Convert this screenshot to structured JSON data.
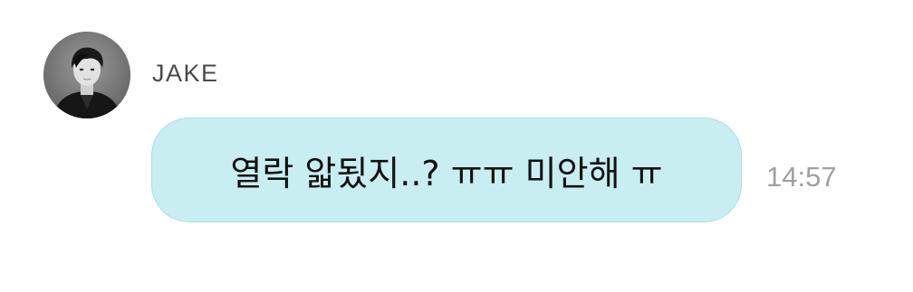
{
  "message": {
    "sender": "JAKE",
    "avatar_icon": "profile-photo-avatar",
    "text": "열락 앏됬지..? ㅠㅠ 미안해 ㅠ",
    "time": "14:57"
  },
  "colors": {
    "background": "#ffffff",
    "bubble": "#c8eef2",
    "bubble_border": "#a9dfe7",
    "sender_text": "#4a4a4a",
    "message_text": "#111111",
    "time_text": "#a0a0a0"
  }
}
